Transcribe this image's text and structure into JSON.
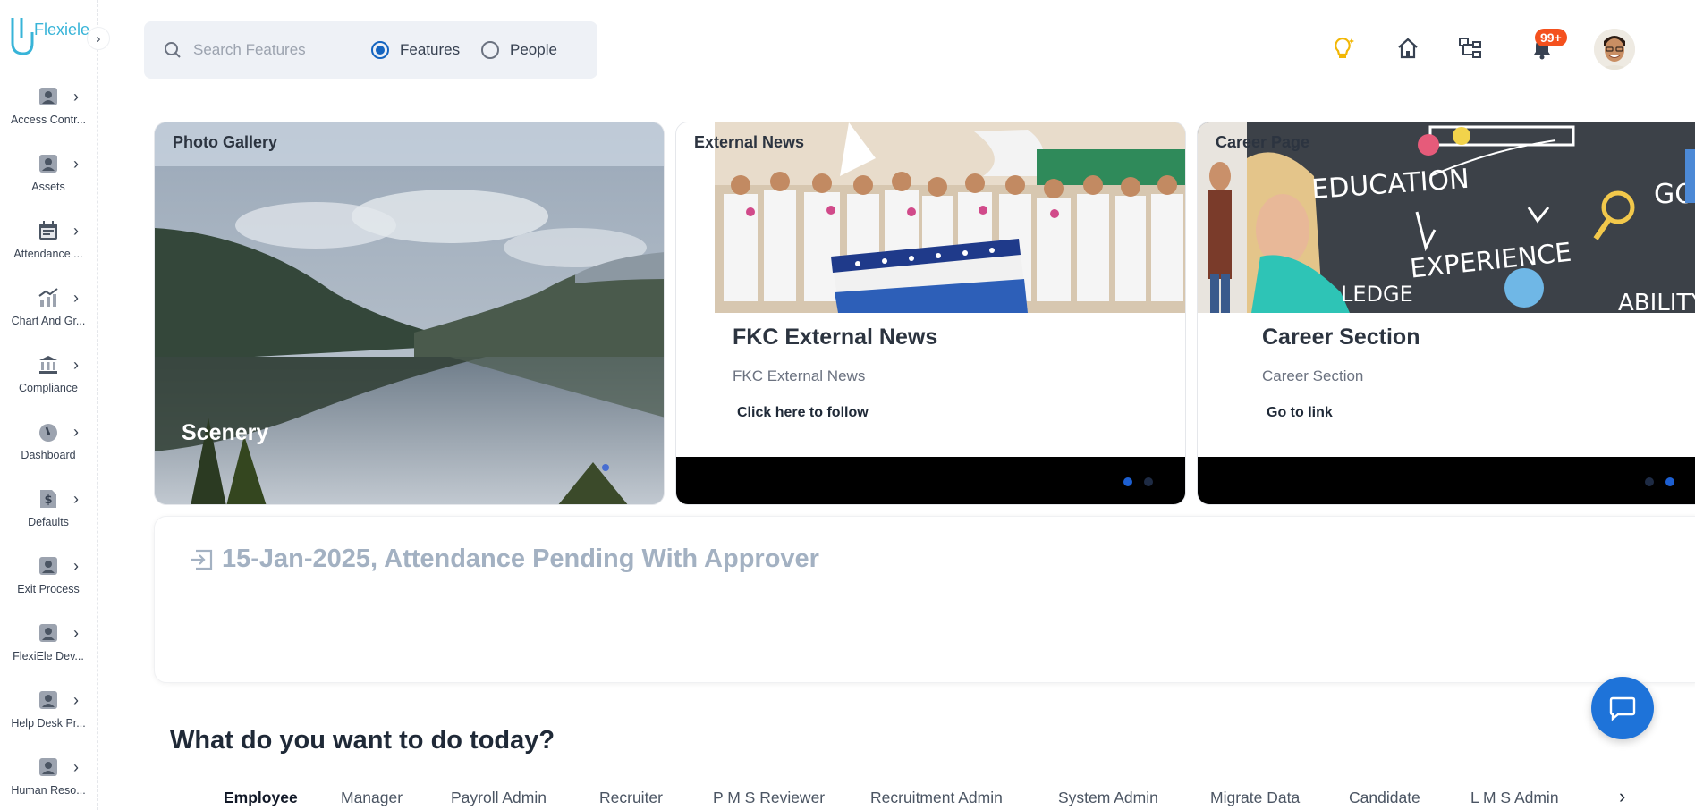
{
  "brand": {
    "name": "Flexiele"
  },
  "sidebar": {
    "items": [
      {
        "label": "Access Contr...",
        "icon": "user-icon"
      },
      {
        "label": "Assets",
        "icon": "user-icon"
      },
      {
        "label": "Attendance ...",
        "icon": "calendar-icon"
      },
      {
        "label": "Chart And Gr...",
        "icon": "chart-icon"
      },
      {
        "label": "Compliance",
        "icon": "bank-icon"
      },
      {
        "label": "Dashboard",
        "icon": "gauge-icon"
      },
      {
        "label": "Defaults",
        "icon": "dollar-doc-icon"
      },
      {
        "label": "Exit Process",
        "icon": "user-icon"
      },
      {
        "label": "FlexiEle Dev...",
        "icon": "user-icon"
      },
      {
        "label": "Help Desk Pr...",
        "icon": "user-icon"
      },
      {
        "label": "Human Reso...",
        "icon": "user-icon"
      }
    ]
  },
  "search": {
    "placeholder": "Search Features",
    "options": [
      "Features",
      "People"
    ],
    "selected": "Features"
  },
  "header": {
    "notification_badge": "99+",
    "icons": [
      "lightbulb-icon",
      "home-icon",
      "org-chart-icon",
      "bell-icon"
    ]
  },
  "cards": {
    "gallery": {
      "header": "Photo Gallery",
      "caption": "Scenery"
    },
    "news": {
      "header": "External News",
      "title": "FKC External News",
      "subtitle": "FKC External News",
      "link": "Click here to follow"
    },
    "career": {
      "header": "Career Page",
      "title": "Career Section",
      "subtitle": "Career Section",
      "link": "Go to link"
    }
  },
  "attendance": {
    "text": "15-Jan-2025, Attendance Pending With Approver"
  },
  "section": {
    "title": "What do you want to do today?"
  },
  "tabs": {
    "items": [
      "Employee",
      "Manager",
      "Payroll Admin",
      "Recruiter",
      "P M S Reviewer",
      "Recruitment Admin",
      "System Admin",
      "Migrate Data",
      "Candidate",
      "L M S Admin"
    ],
    "active": "Employee"
  },
  "colors": {
    "accent": "#1565c0",
    "fab": "#1e73d9",
    "badge": "#f4511e",
    "brand": "#38b4d8"
  }
}
